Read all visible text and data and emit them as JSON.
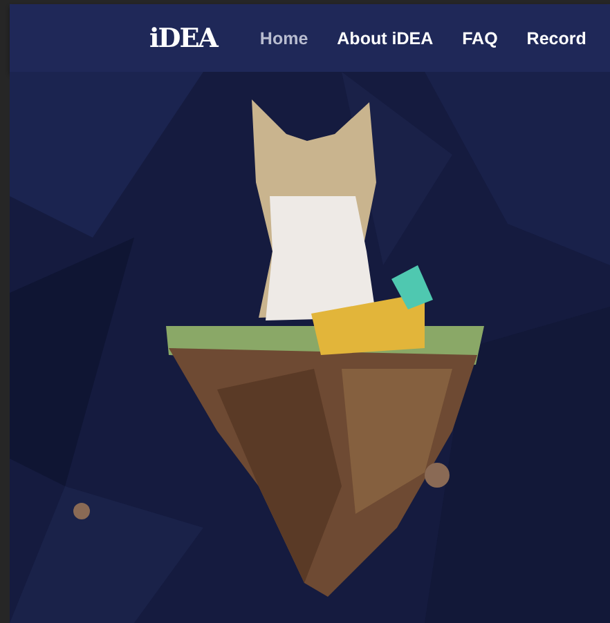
{
  "nav": {
    "logo": "iDEA",
    "items": [
      {
        "label": "Home",
        "selected": true
      },
      {
        "label": "About iDEA",
        "selected": false
      },
      {
        "label": "FAQ",
        "selected": false
      },
      {
        "label": "Record",
        "selected": false
      }
    ]
  }
}
